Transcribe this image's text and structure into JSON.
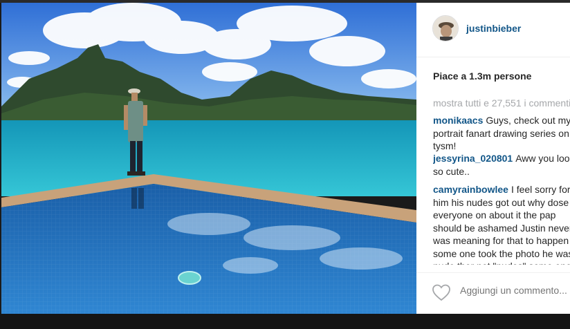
{
  "post": {
    "username": "justinbieber",
    "likes_text": "Piace a 1.3m persone",
    "view_all_text": "mostra tutti e 27,551 i commenti",
    "comments": [
      {
        "user": "monikaacs",
        "text": "Guys, check out my portrait fanart drawing series on tysm!"
      },
      {
        "user": "jessyrina_020801",
        "text": "Aww you look so cute.."
      },
      {
        "user": "camyrainbowlee",
        "text": "I feel sorry for him his nudes got out why dose everyone on about it the pap should be ashamed Justin never was meaning for that to happen some one took the photo he was nude ther not \"nudes\" some one took them put ure self in his shoes it"
      }
    ],
    "add_comment_placeholder": "Aggiungi un commento..."
  },
  "colors": {
    "link": "#125688",
    "muted": "#a5a7aa",
    "text": "#262626"
  },
  "icons": {
    "like": "heart-outline-icon"
  }
}
